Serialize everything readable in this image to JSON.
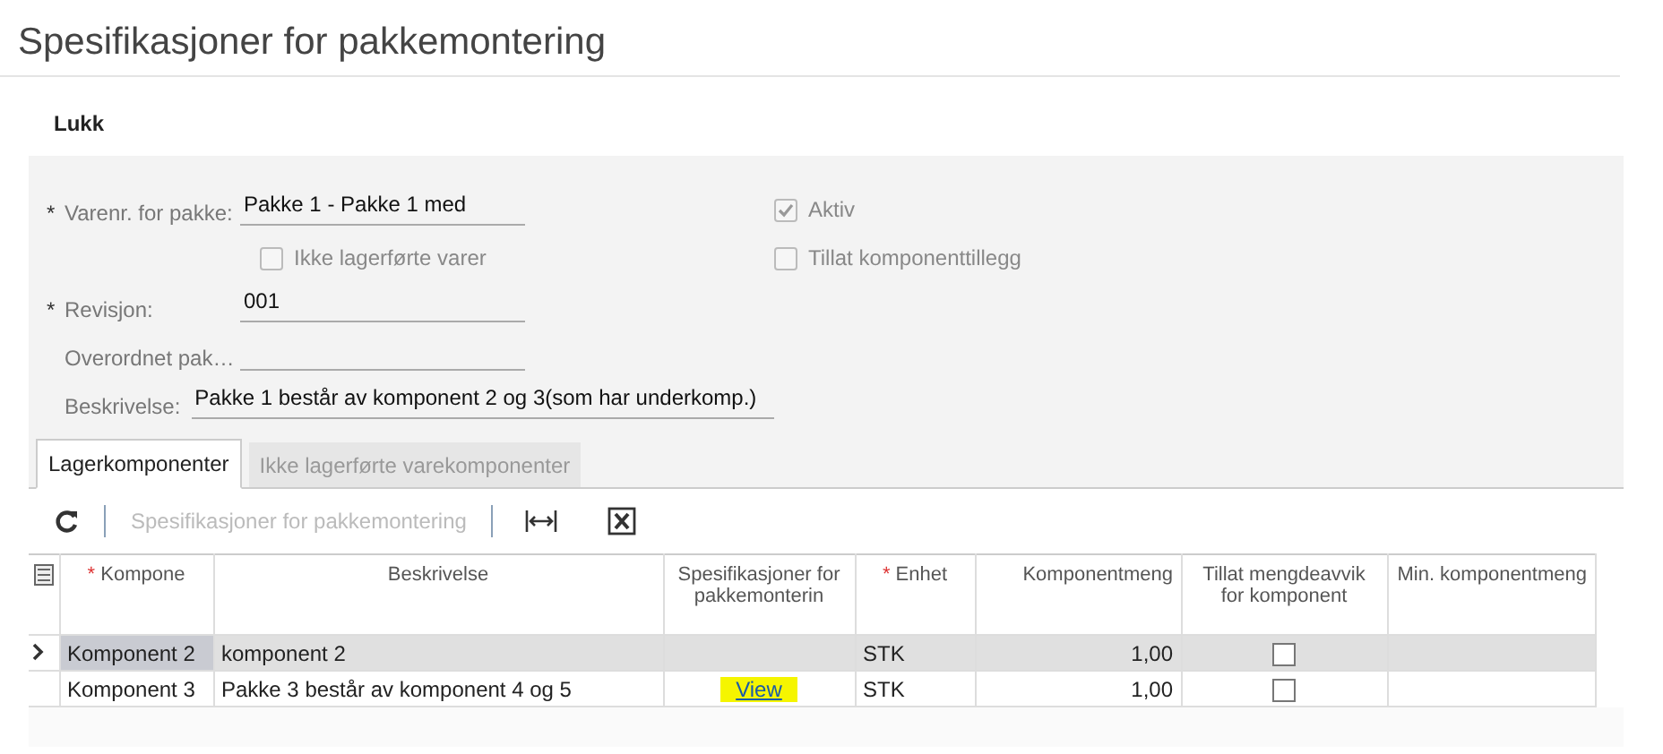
{
  "page_title": "Spesifikasjoner for pakkemontering",
  "toolbar": [
    {
      "label": "Lukk"
    }
  ],
  "form": {
    "rows": [
      {
        "kind": "field",
        "label": "Varenr. for pakke:",
        "required_mark": "*",
        "value": "Pakke 1 - Pakke 1 med",
        "wide": false,
        "side": {
          "label": "Aktiv",
          "checked": true,
          "disabled": true
        }
      },
      {
        "kind": "check",
        "label": "Ikke lagerførte varer",
        "checked": false,
        "disabled": true,
        "side": {
          "label": "Tillat komponenttillegg",
          "checked": false,
          "disabled": true
        }
      },
      {
        "kind": "field",
        "label": "Revisjon:",
        "required_mark": "*",
        "value": "001",
        "wide": false
      },
      {
        "kind": "field",
        "label": "Overordnet pak…",
        "wide": false
      },
      {
        "kind": "field",
        "label": "Beskrivelse:",
        "value": "Pakke 1 består av komponent 2 og 3(som har underkomp.)",
        "wide": true
      }
    ]
  },
  "tabs": [
    {
      "label": "Lagerkomponenter",
      "selected": true
    },
    {
      "label": "Ikke lagerførte varekomponenter",
      "selected": false
    }
  ],
  "grid_toolbar": [
    {
      "kind": "refresh"
    },
    {
      "kind": "separator"
    },
    {
      "kind": "text",
      "label": "Spesifikasjoner for pakkemontering",
      "disabled": true
    },
    {
      "kind": "separator"
    },
    {
      "kind": "fit"
    },
    {
      "kind": "excel"
    }
  ],
  "columns": [
    {
      "label": "Kompone",
      "required_mark": "*"
    },
    {
      "label": "Beskrivelse"
    },
    {
      "label": "Spesifikasjoner for pakkemonterin"
    },
    {
      "label": "Enhet",
      "required_mark": "*"
    },
    {
      "label": "Komponentmeng"
    },
    {
      "label": "Tillat mengdeavvik for komponent"
    },
    {
      "label": "Min. komponentmeng"
    }
  ],
  "rows": [
    {
      "selected": true,
      "komponent": "Komponent 2",
      "beskrivelse": "komponent 2",
      "enhet": "STK",
      "mengde": "1,00",
      "tillat_avvik": false
    },
    {
      "selected": false,
      "komponent": "Komponent 3",
      "beskrivelse": "Pakke 3 består av komponent 4 og 5",
      "link": {
        "label": "View",
        "highlighted": true
      },
      "enhet": "STK",
      "mengde": "1,00",
      "tillat_avvik": false
    }
  ]
}
